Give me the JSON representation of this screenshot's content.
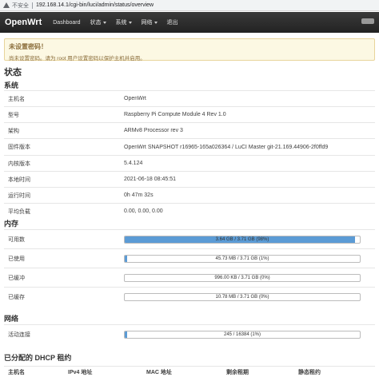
{
  "browser": {
    "insecure_label": "不安全",
    "url": "192.168.14.1/cgi-bin/luci/admin/status/overview"
  },
  "navbar": {
    "brand": "OpenWrt",
    "items": [
      "Dashboard",
      "状态",
      "系统",
      "网络",
      "退出"
    ],
    "badge": ""
  },
  "alert": {
    "title": "未设置密码！",
    "text": "尚未设置密码。请为 root 用户设置密码以保护主机并启用。"
  },
  "page_title": "状态",
  "system": {
    "heading": "系统",
    "rows": [
      {
        "label": "主机名",
        "value": "OpenWrt"
      },
      {
        "label": "型号",
        "value": "Raspberry Pi Compute Module 4 Rev 1.0"
      },
      {
        "label": "架构",
        "value": "ARMv8 Processor rev 3"
      },
      {
        "label": "固件版本",
        "value": "OpenWrt SNAPSHOT r16965-165a026364 / LuCI Master git-21.169.44906-2f0ffd9"
      },
      {
        "label": "内核版本",
        "value": "5.4.124"
      },
      {
        "label": "本地时间",
        "value": "2021-06-18 08:45:51"
      },
      {
        "label": "运行时间",
        "value": "0h 47m 32s"
      },
      {
        "label": "平均负载",
        "value": "0.00, 0.00, 0.00"
      }
    ]
  },
  "memory": {
    "heading": "内存",
    "rows": [
      {
        "label": "可用数",
        "text": "3.64 GB / 3.71 GB (98%)",
        "percent": 98
      },
      {
        "label": "已使用",
        "text": "45.73 MB / 3.71 GB (1%)",
        "percent": 1
      },
      {
        "label": "已缓冲",
        "text": "996.00 KB / 3.71 GB (0%)",
        "percent": 0
      },
      {
        "label": "已缓存",
        "text": "10.78 MB / 3.71 GB (0%)",
        "percent": 0
      }
    ]
  },
  "network": {
    "heading": "网络",
    "rows": [
      {
        "label": "活动连接",
        "text": "245 / 16384 (1%)",
        "percent": 1
      }
    ]
  },
  "dhcp": {
    "heading": "已分配的 DHCP 租约",
    "columns": [
      "主机名",
      "IPv4 地址",
      "MAC 地址",
      "剩余租期",
      "静态租约"
    ]
  },
  "colors": {
    "navbar": "#222222",
    "bar_fill": "#5b9bd5",
    "alert_bg": "#fcf8e3"
  }
}
